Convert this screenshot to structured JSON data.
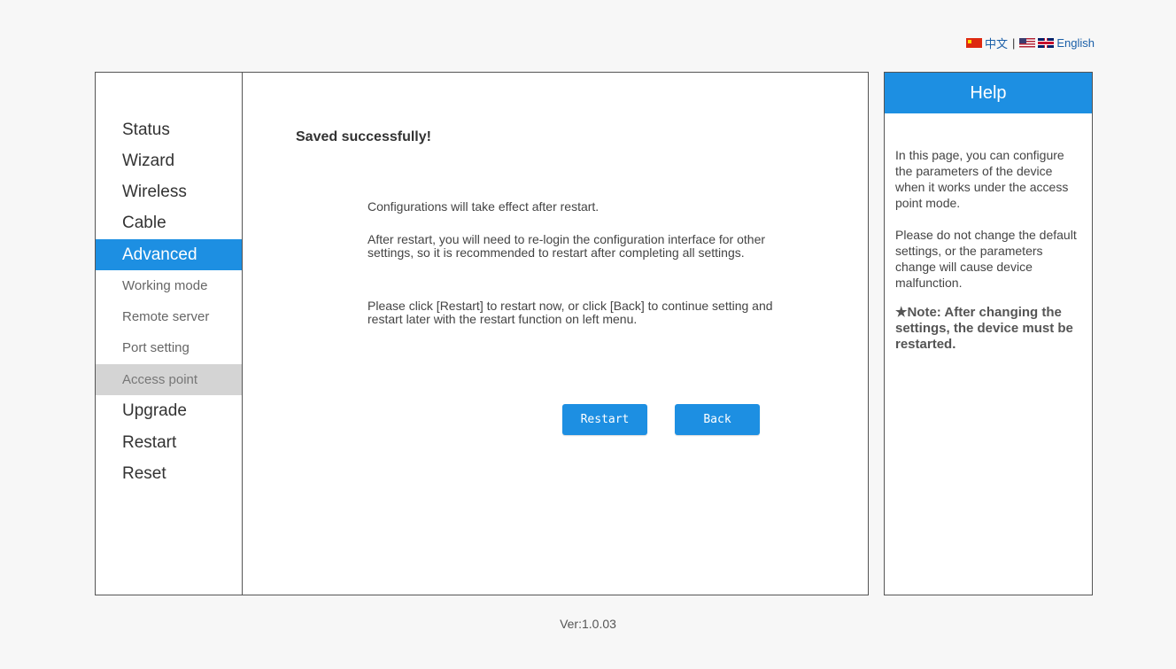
{
  "language": {
    "chinese": "中文",
    "separator": "|",
    "english": "English"
  },
  "nav": {
    "status": "Status",
    "wizard": "Wizard",
    "wireless": "Wireless",
    "cable": "Cable",
    "advanced": "Advanced",
    "working_mode": "Working mode",
    "remote_server": "Remote server",
    "port_setting": "Port setting",
    "access_point": "Access point",
    "upgrade": "Upgrade",
    "restart": "Restart",
    "reset": "Reset"
  },
  "main": {
    "title": "Saved successfully!",
    "msg1": "Configurations will take effect after restart.",
    "msg2": "After restart, you will need to re-login the configuration interface for other settings, so it is recommended to restart after completing all settings.",
    "msg3": "Please click [Restart] to restart now, or click [Back] to continue setting and restart later with the restart function on left menu.",
    "restart_button": "Restart",
    "back_button": "Back"
  },
  "help": {
    "title": "Help",
    "p1": "In this page, you can configure the parameters of the device when it works under the access point mode.",
    "p2": "Please do not change the default settings, or the parameters change will cause device malfunction.",
    "note": "★Note: After changing the settings, the device must be restarted."
  },
  "footer": {
    "version": "Ver:1.0.03"
  },
  "colors": {
    "accent": "#1d8fe2",
    "selected_sub": "#d4d4d4"
  }
}
